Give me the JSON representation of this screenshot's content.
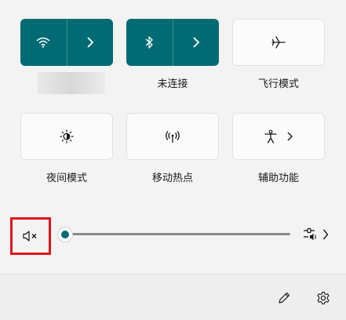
{
  "tiles": {
    "wifi": {
      "label": "",
      "state": "on"
    },
    "bluetooth": {
      "label": "未连接",
      "state": "on"
    },
    "airplane": {
      "label": "飞行模式",
      "state": "off"
    },
    "night_light": {
      "label": "夜间模式",
      "state": "off"
    },
    "hotspot": {
      "label": "移动热点",
      "state": "off"
    },
    "accessibility": {
      "label": "辅助功能",
      "state": "off"
    }
  },
  "volume": {
    "muted": true,
    "level": 0
  },
  "icons": {
    "wifi": "wifi-icon",
    "bluetooth": "bluetooth-icon",
    "airplane": "airplane-icon",
    "night_light": "brightness-icon",
    "hotspot": "hotspot-icon",
    "accessibility": "accessibility-icon",
    "mute": "speaker-muted-icon",
    "audio_output": "audio-output-icon",
    "edit": "pencil-icon",
    "settings": "gear-icon"
  },
  "colors": {
    "accent": "#006b73",
    "highlight": "#e0141c",
    "background": "#f3f3f3"
  }
}
